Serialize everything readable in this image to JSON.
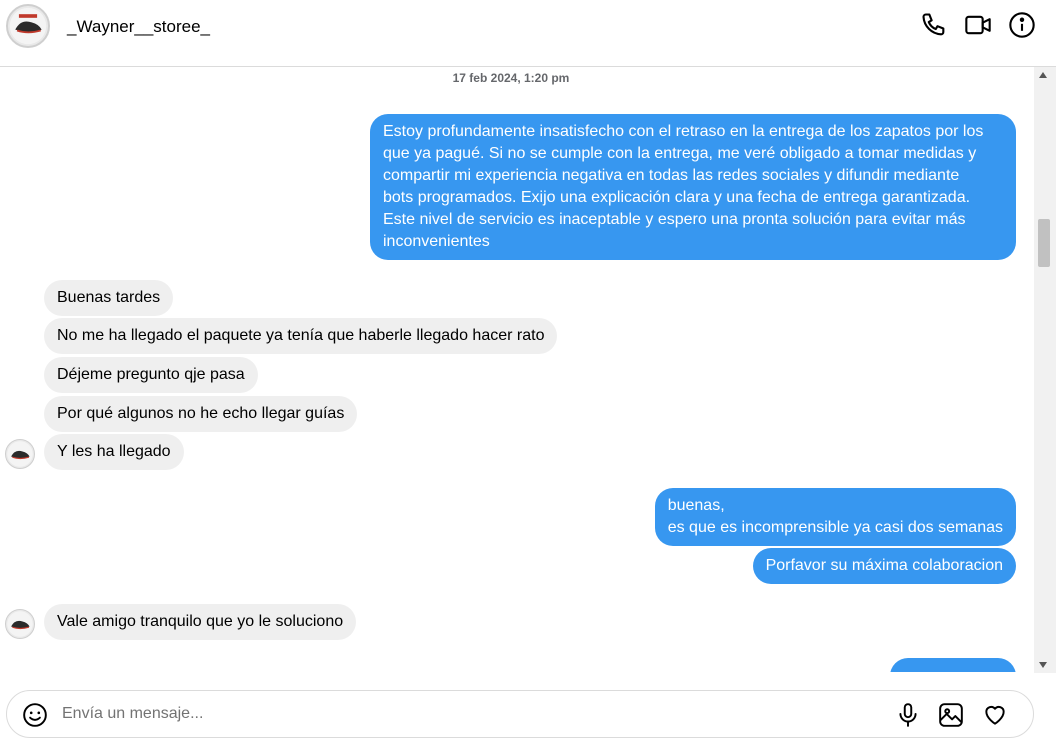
{
  "header": {
    "username": "_Wayner__storee_",
    "icons": [
      "phone-icon",
      "video-call-icon",
      "info-icon"
    ]
  },
  "thread": {
    "date_label": "17 feb 2024, 1:20 pm",
    "messages": [
      {
        "from": "me",
        "text": "Estoy profundamente insatisfecho con el retraso en la entrega de los zapatos por los\nque ya pagué. Si no se cumple con la entrega, me veré obligado a tomar medidas y\ncompartir mi experiencia negativa en todas las redes sociales y difundir mediante\nbots programados. Exijo una explicación clara y una fecha de entrega garantizada.\nEste nivel de servicio es inaceptable y espero una pronta solución para evitar más\ninconvenientes"
      },
      {
        "from": "them",
        "text": "Buenas tardes"
      },
      {
        "from": "them",
        "text": "No me ha llegado el paquete ya tenía que haberle llegado hacer rato"
      },
      {
        "from": "them",
        "text": "Déjeme pregunto qje pasa"
      },
      {
        "from": "them",
        "text": "Por qué algunos no he echo llegar guías"
      },
      {
        "from": "them",
        "text": "Y les ha llegado"
      },
      {
        "from": "me",
        "text": "buenas,\nes que es incomprensible ya casi dos semanas"
      },
      {
        "from": "me",
        "text": "Porfavor su máxima colaboracion"
      },
      {
        "from": "them",
        "text": "Vale amigo tranquilo que yo le soluciono"
      }
    ]
  },
  "composer": {
    "placeholder": "Envía un mensaje...",
    "icons": [
      "emoji-icon",
      "microphone-icon",
      "image-icon",
      "heart-icon"
    ]
  },
  "colors": {
    "outgoing_bubble": "#3797f0",
    "incoming_bubble": "#efefef",
    "date_text": "#65676b"
  }
}
